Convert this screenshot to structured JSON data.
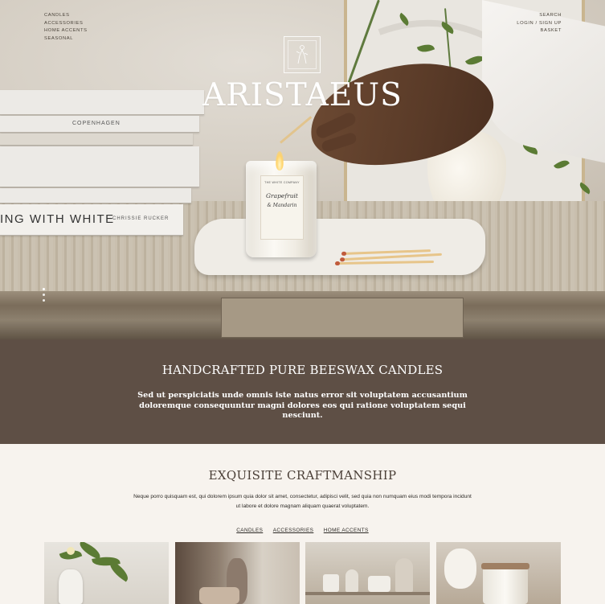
{
  "nav": {
    "left": [
      "CANDLES",
      "ACCESSORIES",
      "HOME ACCENTS",
      "SEASONAL"
    ],
    "right": [
      "SEARCH",
      "LOGIN / SIGN UP",
      "BASKET"
    ]
  },
  "hero": {
    "brand": "ARISTAEUS",
    "logo_icon": "classical-figure-emblem",
    "slides": 3,
    "active_slide": 1,
    "book_spines": [
      "COPENHAGEN",
      "ING WITH WHITE",
      "CHRISSIE RUCKER"
    ],
    "candle_label": [
      "THE WHITE COMPANY",
      "Grapefruit",
      "& Mandarin"
    ]
  },
  "banner": {
    "title": "HANDCRAFTED PURE BEESWAX CANDLES",
    "text": "Sed ut perspiciatis unde omnis iste natus error sit voluptatem accusantium doloremque consequuntur magni dolores eos qui ratione voluptatem sequi nesciunt.",
    "bg_color": "#5e4f45"
  },
  "craft": {
    "title": "EXQUISITE CRAFTMANSHIP",
    "text": "Neque porro quisquam est, qui dolorem ipsum quia dolor sit amet, consectetur, adipisci velit, sed quia non numquam eius modi tempora incidunt ut labore et dolore magnam aliquam quaerat voluptatem.",
    "links": [
      "CANDLES",
      "ACCESSORIES",
      "HOME ACCENTS"
    ]
  },
  "tiles": [
    {
      "name": "plant-vase-tile"
    },
    {
      "name": "vase-jar-tile"
    },
    {
      "name": "shelf-decor-tile"
    },
    {
      "name": "candle-jar-tile"
    }
  ]
}
